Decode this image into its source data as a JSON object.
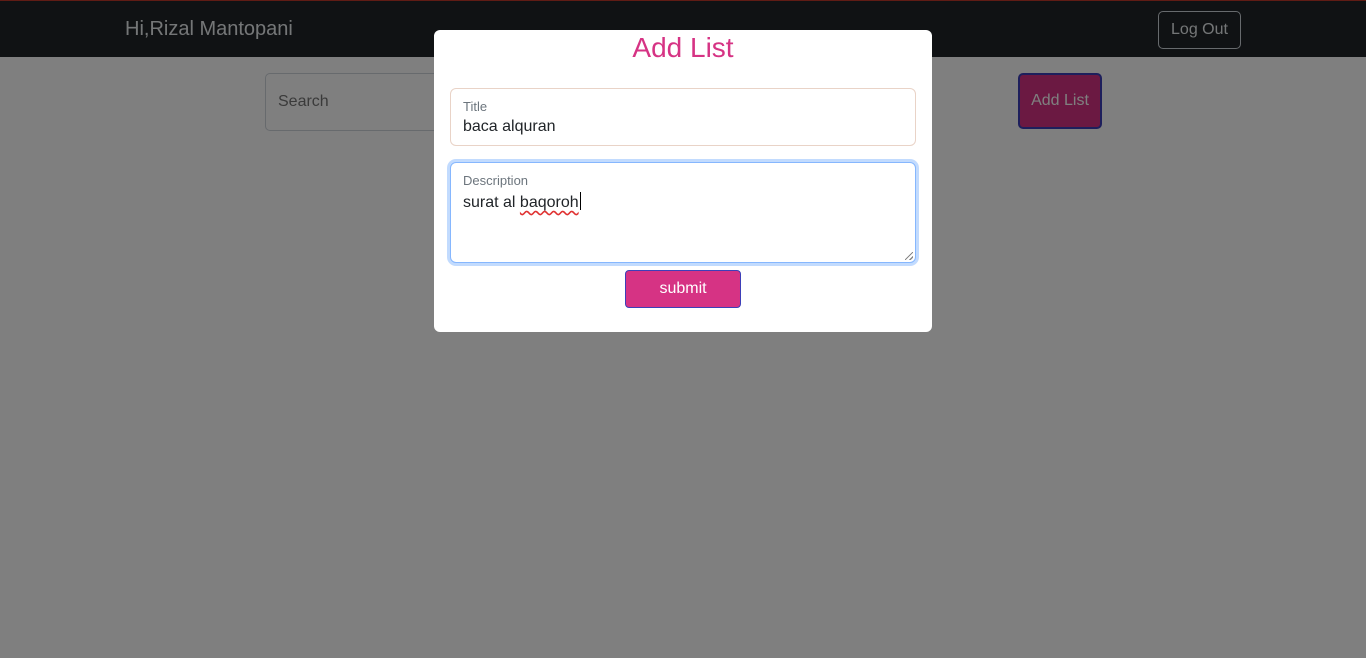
{
  "navbar": {
    "greeting": "Hi,Rizal Mantopani",
    "logout_label": "Log Out"
  },
  "main": {
    "search_placeholder": "Search",
    "add_list_label": "Add List"
  },
  "modal": {
    "title": "Add List",
    "title_field": {
      "label": "Title",
      "value": "baca alquran"
    },
    "description_field": {
      "label": "Description",
      "value_prefix": "surat al ",
      "value_misspelled": "baqoroh"
    },
    "submit_label": "submit"
  },
  "colors": {
    "accent": "#d63384",
    "navbar_bg": "#212529",
    "backdrop": "rgba(0,0,0,0.5)",
    "focus_ring": "#86b7fe"
  }
}
